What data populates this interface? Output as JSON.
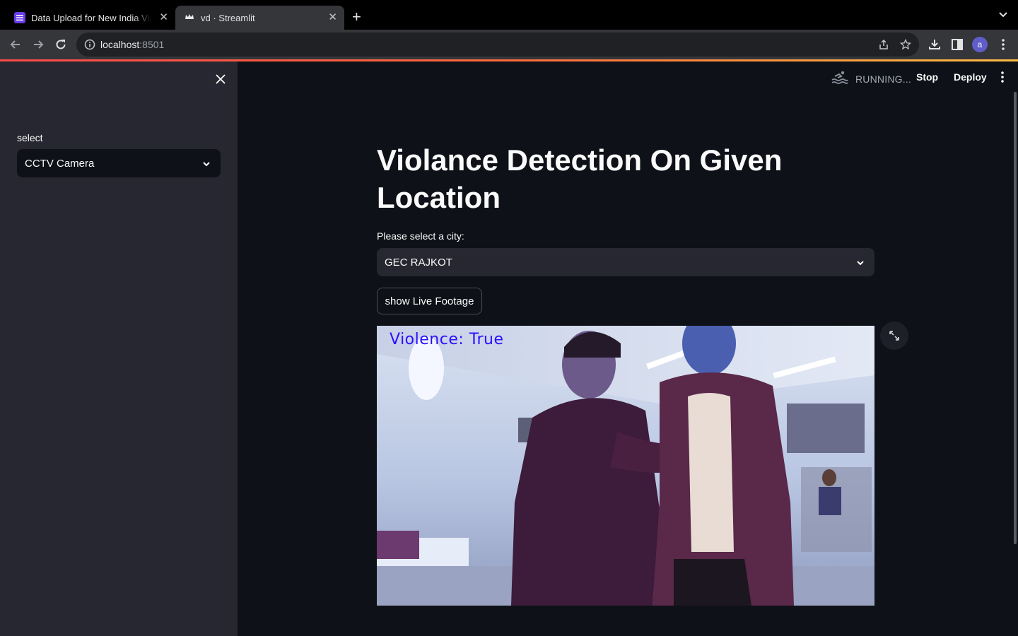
{
  "browser": {
    "tabs": [
      {
        "title": "Data Upload for New India Vibrant"
      },
      {
        "title": "vd · Streamlit"
      }
    ],
    "url_host": "localhost",
    "url_port": ":8501",
    "avatar_letter": "a"
  },
  "app": {
    "status": "RUNNING...",
    "stop_label": "Stop",
    "deploy_label": "Deploy"
  },
  "sidebar": {
    "select_label": "select",
    "select_value": "CCTV Camera"
  },
  "main": {
    "title": "Violance Detection On Given Location",
    "city_label": "Please select a city:",
    "city_value": "GEC RAJKOT",
    "button_label": "show Live Footage",
    "frame_overlay": "Violence: True"
  },
  "colors": {
    "background": "#0e1117",
    "sidebar": "#262730",
    "overlay_text": "#2b10ff",
    "loading_bar_start": "#ff4b4b",
    "loading_bar_end": "#ffbd45"
  }
}
